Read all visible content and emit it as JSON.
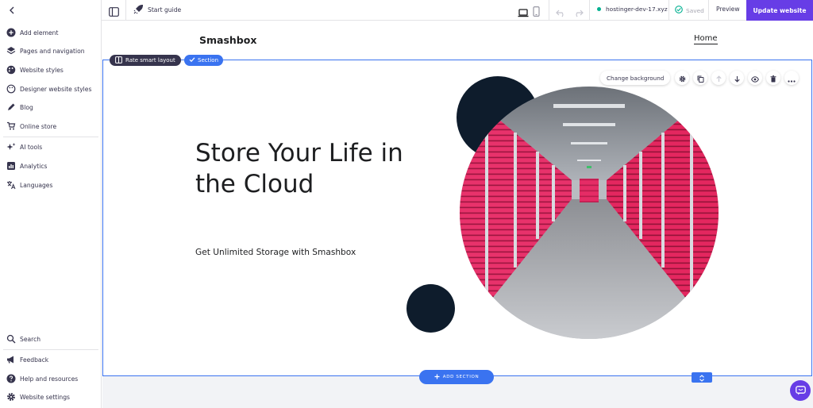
{
  "sidebar": {
    "items": [
      {
        "label": "Add element",
        "icon": "plus-circle-icon"
      },
      {
        "label": "Pages and navigation",
        "icon": "layers-icon"
      },
      {
        "label": "Website styles",
        "icon": "palette-icon"
      },
      {
        "label": "Designer website styles",
        "icon": "palette-outline-icon"
      },
      {
        "label": "Blog",
        "icon": "pen-icon"
      },
      {
        "label": "Online store",
        "icon": "cart-icon"
      },
      {
        "label": "AI tools",
        "icon": "sparkles-icon"
      },
      {
        "label": "Analytics",
        "icon": "bar-chart-icon"
      },
      {
        "label": "Languages",
        "icon": "translate-icon"
      }
    ],
    "bottom_items": [
      {
        "label": "Search",
        "icon": "search-icon"
      },
      {
        "label": "Feedback",
        "icon": "megaphone-icon"
      },
      {
        "label": "Help and resources",
        "icon": "help-icon"
      },
      {
        "label": "Website settings",
        "icon": "gear-icon"
      }
    ]
  },
  "topbar": {
    "start_guide": "Start guide",
    "domain": "hostinger-dev-17.xyz",
    "saved": "Saved",
    "preview": "Preview",
    "update": "Update website"
  },
  "site": {
    "logo": "Smashbox",
    "nav_home": "Home",
    "hero_title": "Store Your Life in the Cloud",
    "hero_subtitle": "Get Unlimited Storage with Smashbox"
  },
  "editor": {
    "rate_layout": "Rate smart layout",
    "section": "Section",
    "change_background": "Change background",
    "add_section": "ADD SECTION"
  },
  "colors": {
    "accent": "#673de6",
    "selection": "#3a73f0",
    "navy": "#0e1c2c",
    "storage_red": "#e0245e"
  }
}
